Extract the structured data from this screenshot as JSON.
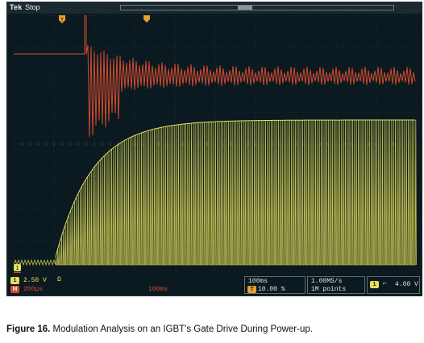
{
  "scope": {
    "brand": "Tek",
    "run_status": "Stop"
  },
  "markers": {
    "trigger_position_icon": "T-marker-icon",
    "channel1_ground": "1",
    "math_ground": "M"
  },
  "readout": {
    "ch1_label": "1",
    "ch1_scale": "2.50 V",
    "ch1_coupling_icon": "ohm-icon",
    "ch1_coupling": "Ω",
    "math_label": "M",
    "math_scale": "200µs",
    "math_timebase": "100ms",
    "horizontal_scale": "100ms",
    "trigger_position_icon": "T",
    "trigger_position": "10.00 %",
    "sample_rate": "1.00MS/s",
    "record_length": "1M points",
    "trigger_source": "1",
    "trigger_slope_icon": "falling-edge-icon",
    "trigger_slope": "⌐",
    "trigger_level": "4.00 V"
  },
  "caption": {
    "figure_label": "Figure 16.",
    "text": " Modulation Analysis on an IGBT's Gate Drive During Power-up."
  },
  "colors": {
    "channel1": "#e6e05a",
    "math": "#d14a2e",
    "screen": "#0b1a20",
    "grid": "#3a4a4e"
  }
}
